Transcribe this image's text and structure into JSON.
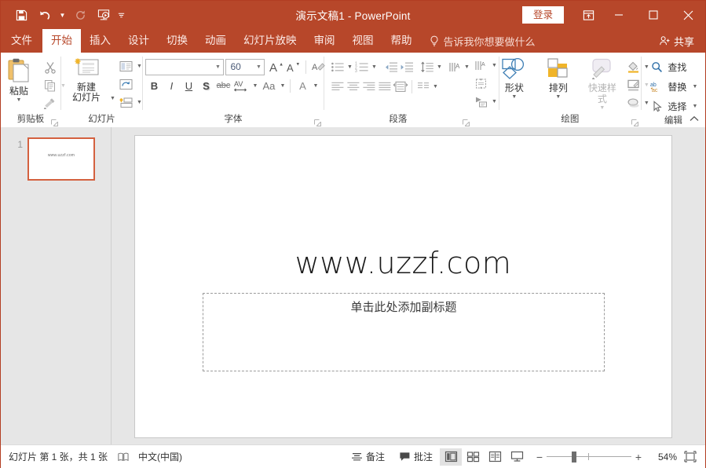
{
  "titlebar": {
    "document_title": "演示文稿1  -  PowerPoint",
    "signin_label": "登录",
    "qat": [
      {
        "name": "save-icon",
        "label": "保存"
      },
      {
        "name": "undo-icon",
        "label": "撤消"
      },
      {
        "name": "redo-icon",
        "label": "恢复"
      },
      {
        "name": "start-slideshow-icon",
        "label": "从头开始"
      },
      {
        "name": "customize-quick-access-toolbar-icon",
        "label": "自定义快速访问工具栏"
      }
    ],
    "ribbon_display_label": "功能区显示选项",
    "minimize_label": "最小化",
    "maximize_label": "最大化",
    "close_label": "关闭",
    "accent_color": "#b7472a"
  },
  "tabs": [
    {
      "label": "文件",
      "active": false
    },
    {
      "label": "开始",
      "active": true
    },
    {
      "label": "插入",
      "active": false
    },
    {
      "label": "设计",
      "active": false
    },
    {
      "label": "切换",
      "active": false
    },
    {
      "label": "动画",
      "active": false
    },
    {
      "label": "幻灯片放映",
      "active": false
    },
    {
      "label": "审阅",
      "active": false
    },
    {
      "label": "视图",
      "active": false
    },
    {
      "label": "帮助",
      "active": false
    }
  ],
  "tellme": {
    "placeholder": "告诉我你想要做什么"
  },
  "share": {
    "label": "共享"
  },
  "ribbon": {
    "clipboard": {
      "group_label": "剪贴板",
      "paste_label": "粘贴",
      "cut_label": "剪切",
      "copy_label": "复制",
      "format_painter_label": "格式刷"
    },
    "slides": {
      "group_label": "幻灯片",
      "new_slide_label": "新建\n幻灯片",
      "new_slide_line1": "新建",
      "new_slide_line2": "幻灯片",
      "layout_label": "版式",
      "reset_label": "重置",
      "section_label": "节"
    },
    "font": {
      "group_label": "字体",
      "font_name_value": "",
      "font_name_placeholder": "",
      "font_size_value": "60",
      "grow_font_label": "增大字号",
      "shrink_font_label": "减小字号",
      "clear_formatting_label": "清除所有格式",
      "bold_label": "B",
      "italic_label": "I",
      "underline_label": "U",
      "shadow_label": "S",
      "strikethrough_label": "abc",
      "char_spacing_label": "AV",
      "change_case_label": "Aa",
      "font_color_label": "A"
    },
    "paragraph": {
      "group_label": "段落",
      "bullets_label": "项目符号",
      "numbering_label": "编号",
      "decrease_indent_label": "减少缩进量",
      "increase_indent_label": "增加缩进量",
      "line_spacing_label": "行距",
      "text_direction_label": "文字方向",
      "align_text_label": "对齐文本",
      "convert_smartart_label": "转换为 SmartArt",
      "align_left_label": "左对齐",
      "align_center_label": "居中",
      "align_right_label": "右对齐",
      "justify_label": "两端对齐",
      "columns_label": "分栏"
    },
    "drawing": {
      "group_label": "绘图",
      "shapes_label": "形状",
      "arrange_label": "排列",
      "quick_styles_label": "快速样式",
      "shape_fill_label": "形状填充",
      "shape_outline_label": "形状轮廓",
      "shape_effects_label": "形状效果"
    },
    "editing": {
      "group_label": "编辑",
      "find_label": "查找",
      "replace_label": "替换",
      "select_label": "选择"
    },
    "collapse_label": "折叠功能区"
  },
  "thumbnails": [
    {
      "number": "1",
      "title": "www.uzzf.com",
      "selected": true
    }
  ],
  "slide": {
    "title": "www.uzzf.com",
    "subtitle_placeholder": "单击此处添加副标题"
  },
  "status": {
    "slide_count_text": "幻灯片 第 1 张，共 1 张",
    "accessibility_label": "辅助功能",
    "language": "中文(中国)",
    "notes_label": "备注",
    "comments_label": "批注",
    "views": [
      {
        "name": "normal-view",
        "label": "普通视图",
        "active": true
      },
      {
        "name": "slide-sorter-view",
        "label": "幻灯片浏览",
        "active": false
      },
      {
        "name": "reading-view",
        "label": "阅读视图",
        "active": false
      },
      {
        "name": "slideshow-view",
        "label": "幻灯片放映",
        "active": false
      }
    ],
    "zoom_out_label": "缩小",
    "zoom_in_label": "放大",
    "zoom_percent": "54%",
    "fit_label": "使幻灯片适应当前窗口"
  }
}
